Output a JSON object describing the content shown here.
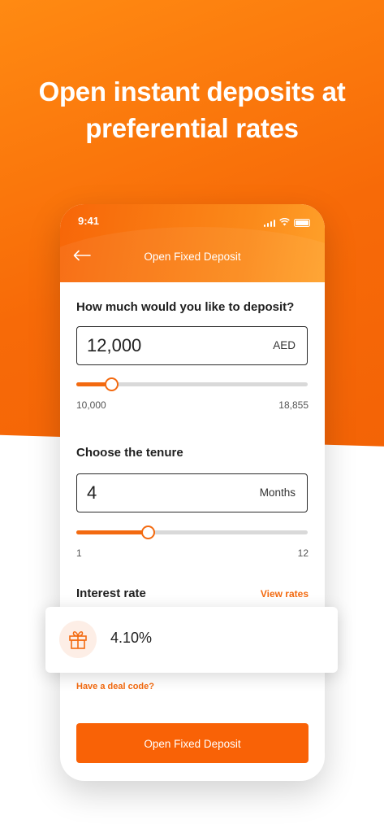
{
  "headline": "Open instant deposits at preferential rates",
  "status_bar": {
    "time": "9:41"
  },
  "header": {
    "back_icon": "back-arrow-icon",
    "title": "Open Fixed Deposit"
  },
  "deposit": {
    "question": "How much would you like to deposit?",
    "amount": "12,000",
    "currency": "AED",
    "min": "10,000",
    "max": "18,855",
    "slider_fraction": 0.15
  },
  "tenure": {
    "question": "Choose the tenure",
    "value": "4",
    "unit": "Months",
    "min": "1",
    "max": "12",
    "slider_fraction": 0.31
  },
  "interest": {
    "label": "Interest rate",
    "view_rates": "View rates",
    "rate": "4.10%",
    "icon": "gift-icon"
  },
  "deal_code_link": "Have a deal code?",
  "cta_label": "Open Fixed Deposit",
  "colors": {
    "accent": "#f36a10",
    "button": "#f96206"
  }
}
